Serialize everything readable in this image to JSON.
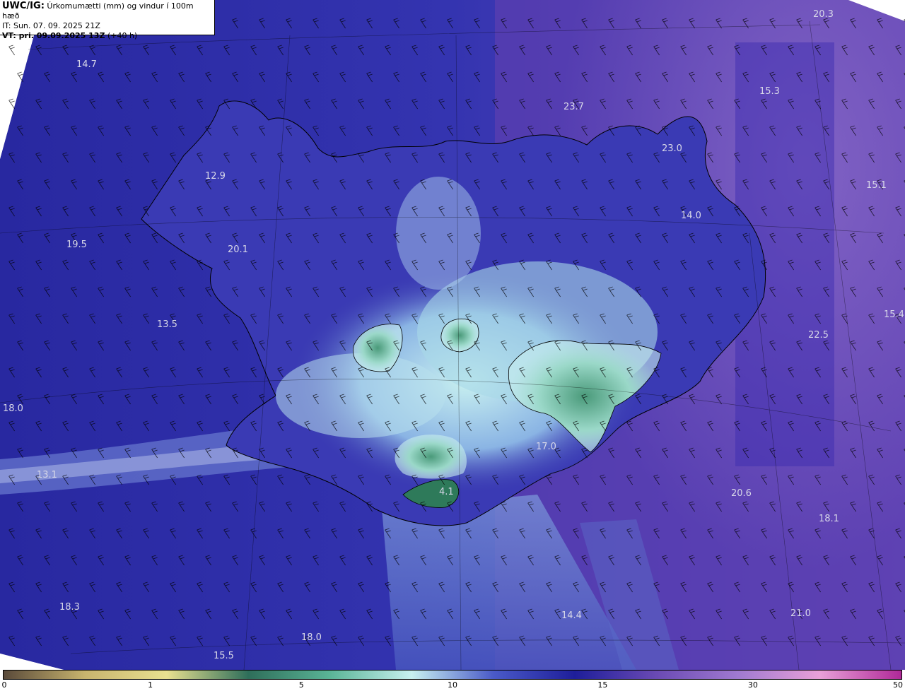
{
  "header": {
    "model": "UWC/IG:",
    "title": "Úrkomumætti (mm) og vindur í 100m hæð",
    "init_time": "IT: Sun. 07. 09. 2025 21Z",
    "valid_prefix": "VT: pri. 09.09.2025 13Z",
    "lead": "(+40 h)"
  },
  "values": [
    {
      "id": "v1",
      "text": "20.3"
    },
    {
      "id": "v2",
      "text": "14.7"
    },
    {
      "id": "v3",
      "text": "15.3"
    },
    {
      "id": "v4",
      "text": "23.7"
    },
    {
      "id": "v5",
      "text": "23.0"
    },
    {
      "id": "v6",
      "text": "12.9"
    },
    {
      "id": "v7",
      "text": "15.1"
    },
    {
      "id": "v8",
      "text": "14.0"
    },
    {
      "id": "v9",
      "text": "19.5"
    },
    {
      "id": "v10",
      "text": "20.1"
    },
    {
      "id": "v11",
      "text": "15.4"
    },
    {
      "id": "v12",
      "text": "13.5"
    },
    {
      "id": "v13",
      "text": "22.5"
    },
    {
      "id": "v14",
      "text": "18.0"
    },
    {
      "id": "v15",
      "text": "17.0"
    },
    {
      "id": "v16",
      "text": "13.1"
    },
    {
      "id": "v17",
      "text": "4.1"
    },
    {
      "id": "v18",
      "text": "20.6"
    },
    {
      "id": "v19",
      "text": "18.1"
    },
    {
      "id": "v20",
      "text": "18.3"
    },
    {
      "id": "v21",
      "text": "14.4"
    },
    {
      "id": "v22",
      "text": "21.0"
    },
    {
      "id": "v23",
      "text": "18.0"
    },
    {
      "id": "v24",
      "text": "15.5"
    }
  ],
  "colorbar": {
    "ticks": [
      {
        "label": "0",
        "value": 0
      },
      {
        "label": "1",
        "value": 1
      },
      {
        "label": "5",
        "value": 5
      },
      {
        "label": "10",
        "value": 10
      },
      {
        "label": "15",
        "value": 15
      },
      {
        "label": "30",
        "value": 30
      },
      {
        "label": "50",
        "value": 50
      }
    ],
    "colors": [
      "#5a4a3a",
      "#c8b46e",
      "#e8e090",
      "#2e6e5a",
      "#5ab496",
      "#c8f0f0",
      "#4a5ac8",
      "#1e1e9a",
      "#6a4ab4",
      "#a07ad0",
      "#e8a0d8",
      "#b02898"
    ]
  },
  "colors": {
    "sea_base": "#2a2aa0",
    "east_sea": "#7a5ec0",
    "land_low": "#b8e8e8",
    "land_green": "#3a8a6a",
    "coast": "#000000"
  }
}
